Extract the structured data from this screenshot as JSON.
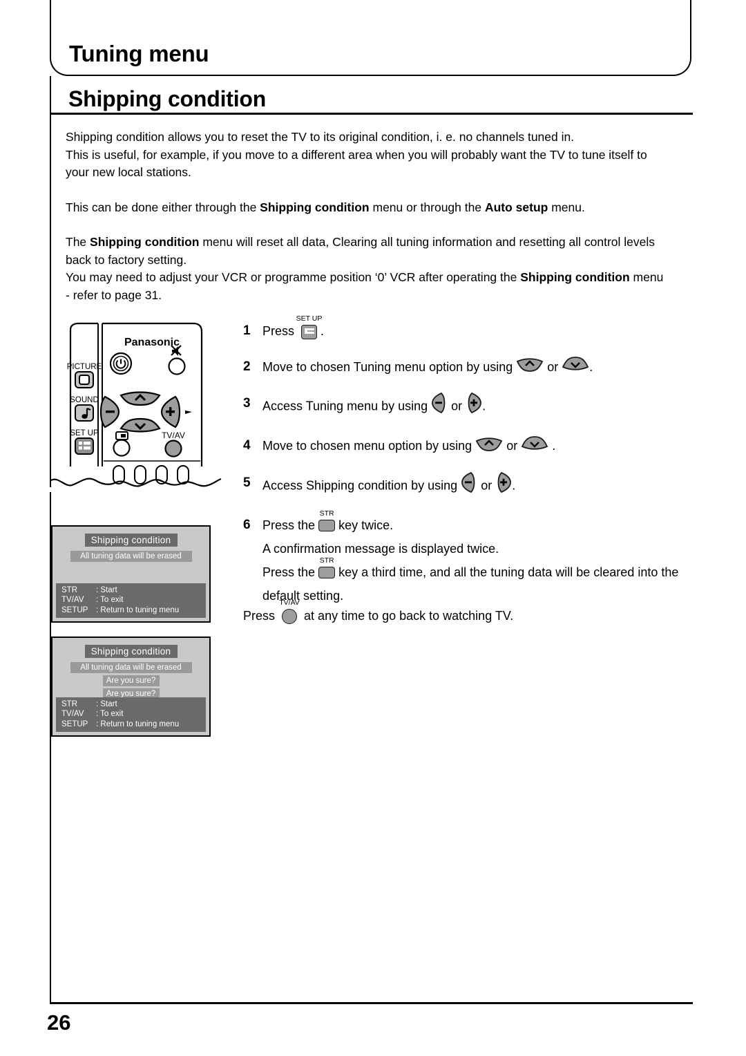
{
  "header": {
    "chapter_title": "Tuning menu",
    "section_title": "Shipping condition"
  },
  "intro": {
    "para1_line1": "Shipping condition allows you to reset the TV to its original condition, i. e. no channels tuned in.",
    "para1_line2": "This is useful, for example, if you move to a different area when you will probably want the TV to tune itself to",
    "para1_line3": "your new local stations.",
    "para2_pre": "This can be done either through the ",
    "para2_bold1": "Shipping condition",
    "para2_mid": " menu or through the ",
    "para2_bold2": "Auto setup",
    "para2_post": " menu.",
    "para3_pre": "The ",
    "para3_bold1": "Shipping condition",
    "para3_post": " menu will reset all data, Clearing all tuning information and resetting all control levels",
    "para3_line2": "back to factory setting.",
    "para4_pre": "You may need to adjust your VCR or programme position ‘0’ VCR after operating the ",
    "para4_bold1": "Shipping condition",
    "para4_post": " menu",
    "para4_line2": "- refer to page 31."
  },
  "remote": {
    "brand": "Panasonic",
    "picture_label": "PICTURE",
    "sound_label": "SOUND",
    "setup_label": "SET UP",
    "tvav_label": "TV/AV"
  },
  "steps": [
    {
      "num": "1",
      "pre": "Press",
      "key_label": "SET UP",
      "post": "."
    },
    {
      "num": "2",
      "pre": "Move to chosen Tuning menu option by using",
      "or": "or",
      "post": "."
    },
    {
      "num": "3",
      "pre": "Access Tuning menu by using",
      "or": "or",
      "post": "."
    },
    {
      "num": "4",
      "pre": "Move to chosen menu option by using",
      "or": "or",
      "post": "."
    },
    {
      "num": "5",
      "pre": "Access Shipping condition by using",
      "or": "or",
      "post": "."
    },
    {
      "num": "6",
      "pre": "Press the",
      "key_label": "STR",
      "post": "key twice.",
      "line2": "A confirmation message is displayed twice.",
      "line3_pre": "Press the",
      "line3_key_label": "STR",
      "line3_post": "key a third time, and all the tuning data will be cleared into the",
      "line4": "default setting."
    }
  ],
  "tail_note": {
    "pre": "Press",
    "key_label": "TV/AV",
    "post": "at any time to go back to watching TV."
  },
  "osd1": {
    "title": "Shipping condition",
    "message": "All tuning data will be erased",
    "footer": [
      {
        "key": "STR",
        "value": ": Start"
      },
      {
        "key": "TV/AV",
        "value": ": To exit"
      },
      {
        "key": "SETUP",
        "value": ": Return to tuning menu"
      }
    ]
  },
  "osd2": {
    "title": "Shipping condition",
    "message": "All tuning data will be erased",
    "confirm1": "Are you sure?",
    "confirm2": "Are you sure?",
    "footer": [
      {
        "key": "STR",
        "value": ": Start"
      },
      {
        "key": "TV/AV",
        "value": ": To exit"
      },
      {
        "key": "SETUP",
        "value": ": Return to tuning menu"
      }
    ]
  },
  "footer": {
    "page_number": "26"
  },
  "colors": {
    "osd_background": "#c9c9c9",
    "osd_bar_dark": "#6a6a6a",
    "osd_bar_mid": "#9a9a9a",
    "button_grey": "#9d9d9d",
    "ink": "#000000"
  }
}
